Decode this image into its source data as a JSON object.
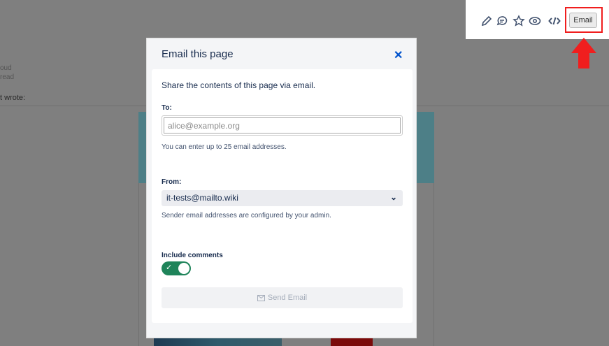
{
  "background": {
    "line1": "oud",
    "line2": "read",
    "wrote": "t wrote:"
  },
  "toolbar": {
    "icons": [
      "pencil-icon",
      "comment-icon",
      "star-icon",
      "eye-icon",
      "code-icon"
    ],
    "email_label": "Email"
  },
  "modal": {
    "title": "Email this page",
    "intro": "Share the contents of this page via email.",
    "to_label": "To:",
    "to_placeholder": "alice@example.org",
    "to_value": "",
    "to_hint": "You can enter up to 25 email addresses.",
    "from_label": "From:",
    "from_value": "it-tests@mailto.wiki",
    "from_hint": "Sender email addresses are configured by your admin.",
    "comments_label": "Include comments",
    "comments_enabled": true,
    "send_label": "Send Email"
  },
  "colors": {
    "toggle": "#1f845a",
    "close": "#0052cc",
    "highlight": "#f01e1e"
  }
}
